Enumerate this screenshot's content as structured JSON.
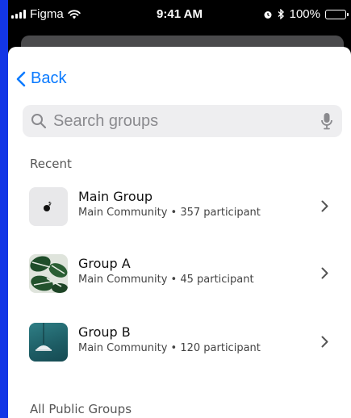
{
  "status_bar": {
    "carrier": "Figma",
    "time": "9:41 AM",
    "battery": "100%"
  },
  "nav": {
    "back_label": "Back"
  },
  "search": {
    "placeholder": "Search groups"
  },
  "sections": {
    "recent": "Recent",
    "all_public": "All Public Groups"
  },
  "groups": [
    {
      "name": "Main Group",
      "subtitle": "Main Community • 357 participant",
      "thumb": "bird-photo"
    },
    {
      "name": "Group A",
      "subtitle": "Main Community • 45 participant",
      "thumb": "monstera-leaves-photo"
    },
    {
      "name": "Group B",
      "subtitle": "Main Community • 120 participant",
      "thumb": "pendant-lamp-photo"
    }
  ],
  "colors": {
    "accent": "#0a7aff",
    "background": "#1336e6"
  }
}
